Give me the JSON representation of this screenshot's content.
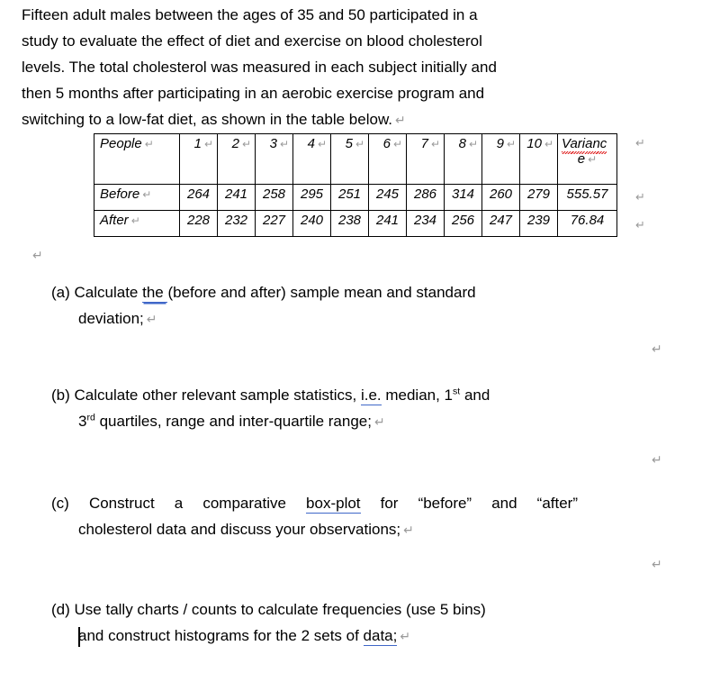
{
  "document": {
    "intro_lines": [
      "Fifteen adult males between the ages of 35 and 50 participated in a",
      "study to evaluate the effect of diet and exercise on blood cholesterol",
      "levels. The total cholesterol was measured in each subject initially and",
      "then 5 months after participating in an aerobic exercise program and",
      "switching to a low-fat diet, as shown in the table below."
    ],
    "pilcrow_glyph": "↵"
  },
  "table": {
    "header": {
      "row_label": "People",
      "people": [
        "1",
        "2",
        "3",
        "4",
        "5",
        "6",
        "7",
        "8",
        "9",
        "10"
      ],
      "variance_part1": "Varianc",
      "variance_part2": "e"
    },
    "rows": [
      {
        "label": "Before",
        "values": [
          "264",
          "241",
          "258",
          "295",
          "251",
          "245",
          "286",
          "314",
          "260",
          "279"
        ],
        "variance": "555.57"
      },
      {
        "label": "After",
        "values": [
          "228",
          "232",
          "227",
          "240",
          "238",
          "241",
          "234",
          "256",
          "247",
          "239"
        ],
        "variance": "76.84"
      }
    ]
  },
  "questions": {
    "a": {
      "label": "(a)",
      "line1_pre": "Calculate ",
      "line1_underlined": "the  ",
      "line1_post": "(before and after) sample mean and standard",
      "line2": "deviation;"
    },
    "b": {
      "label": "(b)",
      "line1_pre": "Calculate other relevant sample statistics, ",
      "line1_underlined": "i.e.",
      "line1_mid": " median, 1",
      "line1_sup": "st",
      "line1_post": " and",
      "line2_num": "3",
      "line2_sup": "rd",
      "line2_rest": " quartiles, range and inter-quartile range;"
    },
    "c": {
      "label": "(c)",
      "line1_pre": "Construct a comparative ",
      "line1_underlined": "box-plot",
      "line1_post": " for “before” and “after”",
      "line2": "cholesterol data and discuss your observations;"
    },
    "d": {
      "label": "(d)",
      "line1": "Use tally charts / counts to calculate frequencies (use 5 bins)",
      "line2_pre": "and construct histograms for the 2 sets of ",
      "line2_underlined": "data;"
    }
  },
  "colors": {
    "spellcheck_underline": "#e02020",
    "grammar_underline": "#3f67c8",
    "paragraph_mark": "#9a9a9a",
    "text": "#000000",
    "table_border": "#000000",
    "page_background": "#ffffff"
  }
}
